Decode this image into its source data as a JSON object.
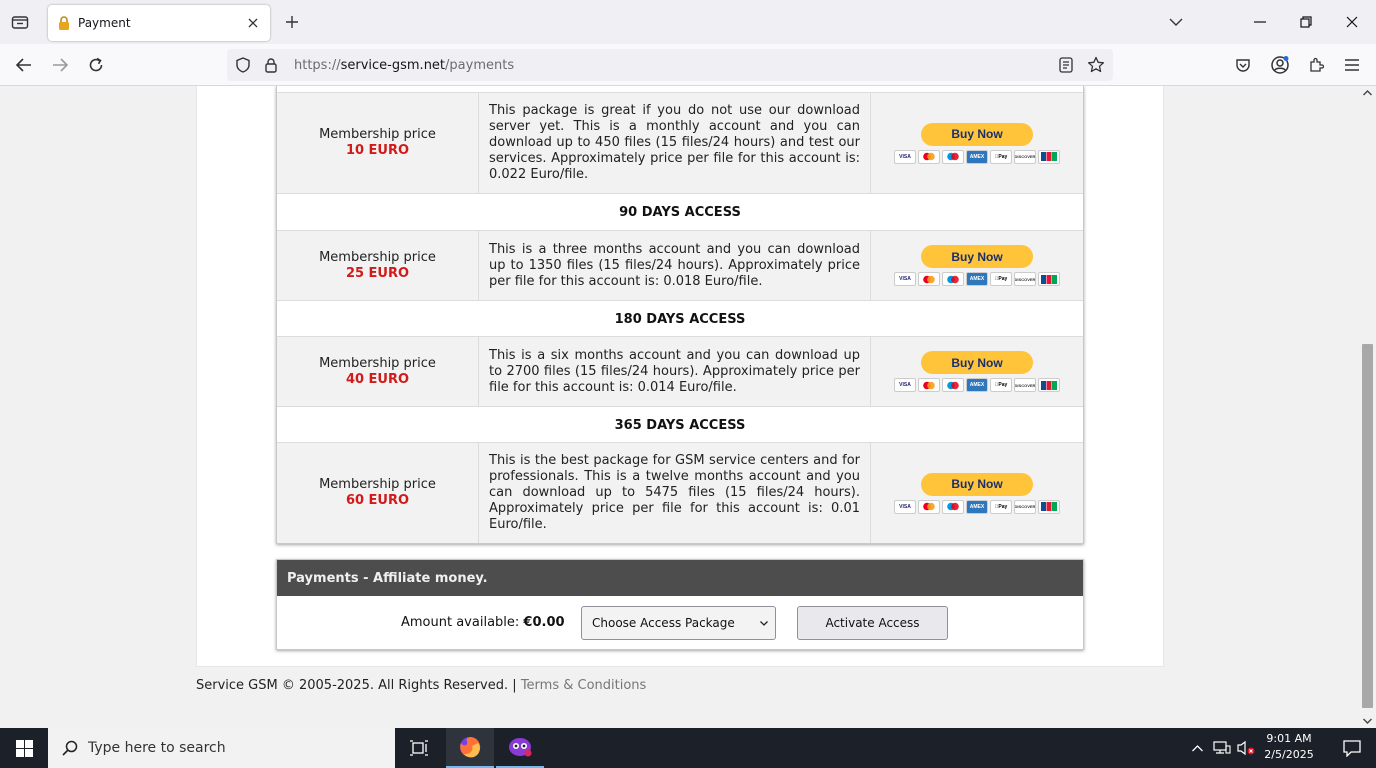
{
  "browser": {
    "tab_title": "Payment",
    "url_scheme": "https://",
    "url_host": "service-gsm.net",
    "url_path": "/payments"
  },
  "packages": {
    "rows": [
      {
        "label": "Membership price",
        "price": "10 EURO",
        "description": "This package is great if you do not use our download server yet. This is a monthly account and you can download up to 450 files (15 files/24 hours) and test our services. Approximately price per file for this account is: 0.022 Euro/file.",
        "buy": "Buy Now"
      },
      {
        "label": "Membership price",
        "price": "25 EURO",
        "description": "This is a three months account and you can download up to 1350 files (15 files/24 hours). Approximately price per file for this account is: 0.018 Euro/file.",
        "buy": "Buy Now"
      },
      {
        "label": "Membership price",
        "price": "40 EURO",
        "description": "This is a six months account and you can download up to 2700 files (15 files/24 hours). Approximately price per file for this account is: 0.014 Euro/file.",
        "buy": "Buy Now"
      },
      {
        "label": "Membership price",
        "price": "60 EURO",
        "description": "This is the best package for GSM service centers and for professionals. This is a twelve months account and you can download up to 5475 files (15 files/24 hours). Approximately price per file for this account is: 0.01 Euro/file.",
        "buy": "Buy Now"
      }
    ],
    "headers": [
      "90 DAYS ACCESS",
      "180 DAYS ACCESS",
      "365 DAYS ACCESS"
    ],
    "card_icons": [
      "VISA",
      "mastercard",
      "maestro",
      "AMEX",
      "Apple Pay",
      "DISCOVER",
      "JCB"
    ]
  },
  "affiliate": {
    "title": "Payments - Affiliate money.",
    "amount_label": "Amount available:",
    "amount_value": "€0.00",
    "select_value": "Choose Access Package",
    "activate_label": "Activate Access"
  },
  "footer": {
    "copyright": "Service GSM © 2005-2025. All Rights Reserved.",
    "separator": "|",
    "terms": "Terms & Conditions"
  },
  "taskbar": {
    "search_placeholder": "Type here to search",
    "time": "9:01 AM",
    "date": "2/5/2025"
  },
  "colors": {
    "price_red": "#d11a1a",
    "paypal_yellow": "#ffc439",
    "affiliate_header": "#4d4d4d"
  }
}
